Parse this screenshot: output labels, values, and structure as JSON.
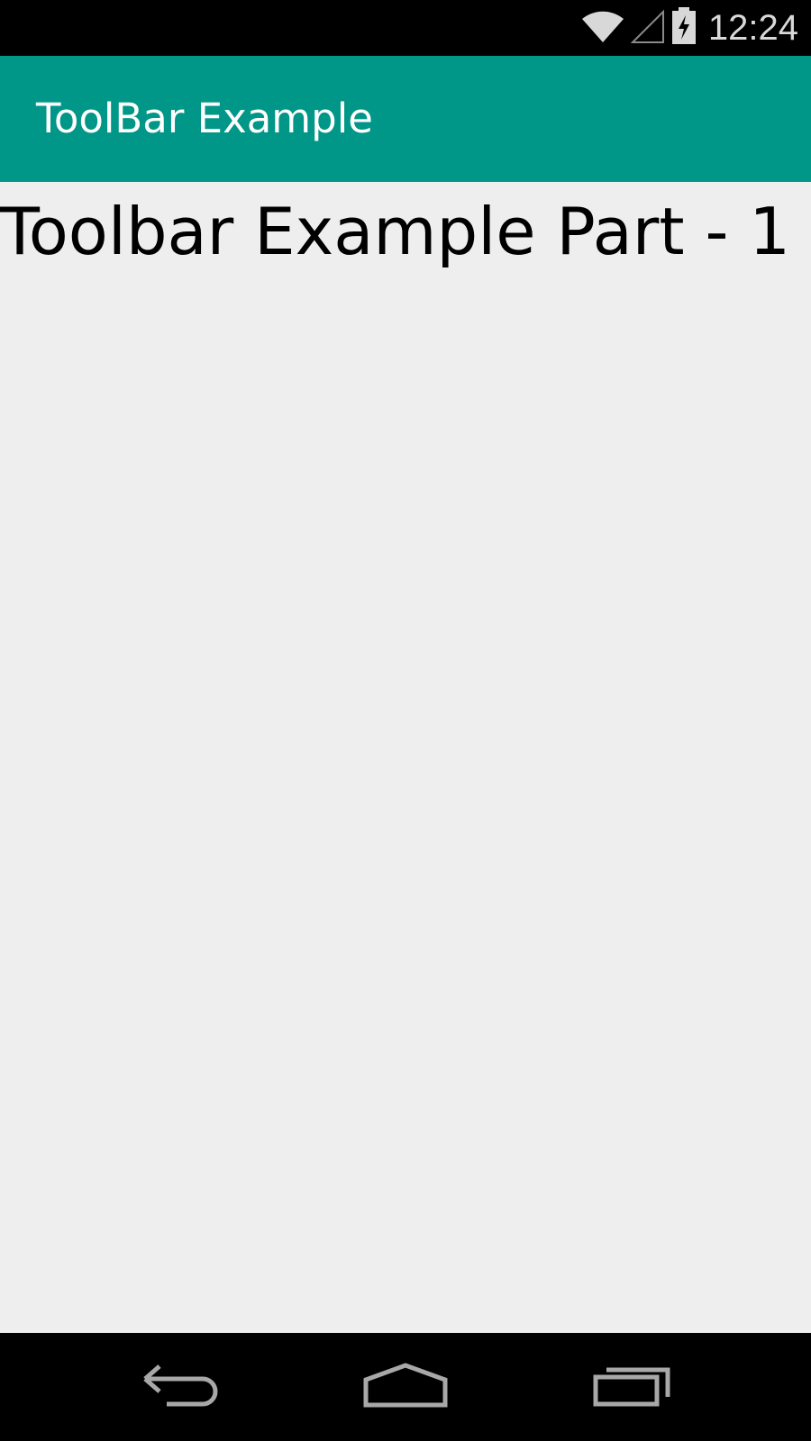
{
  "status_bar": {
    "time": "12:24",
    "icons": [
      "wifi-icon",
      "cell-signal-icon",
      "battery-charging-icon"
    ]
  },
  "toolbar": {
    "title": "ToolBar Example",
    "background_color": "#009688"
  },
  "content": {
    "heading": "Toolbar Example Part - 1",
    "background_color": "#eeeeee"
  },
  "nav_bar": {
    "buttons": [
      "back-icon",
      "home-icon",
      "recents-icon"
    ]
  }
}
